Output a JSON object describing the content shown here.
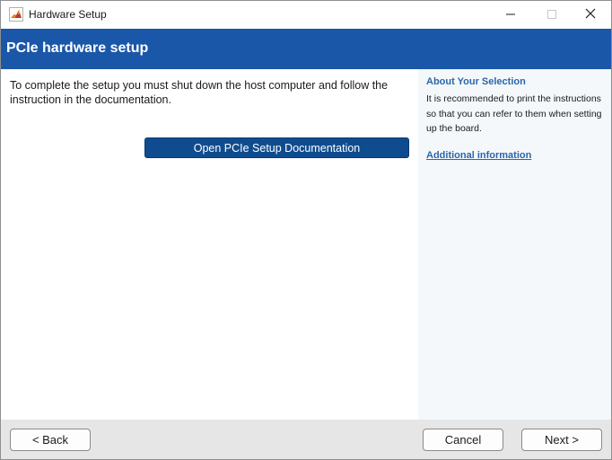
{
  "window": {
    "title": "Hardware Setup",
    "app_icon": "matlab-logo-icon",
    "controls": [
      "minimize-icon",
      "maximize-icon",
      "close-icon"
    ]
  },
  "header": {
    "title": "PCIe hardware setup",
    "background_color": "#1b57a8"
  },
  "main": {
    "instructions": "To complete the setup you must shut down the host computer and follow the instruction in the documentation.",
    "doc_button_label": "Open PCIe Setup Documentation"
  },
  "side_panel": {
    "heading": "About Your Selection",
    "text": "It is recommended to print the instructions so that you can refer to them when setting up the board.",
    "link_label": "Additional information",
    "accent_color": "#2a67a8"
  },
  "footer": {
    "back_label": "< Back",
    "cancel_label": "Cancel",
    "next_label": "Next >"
  }
}
